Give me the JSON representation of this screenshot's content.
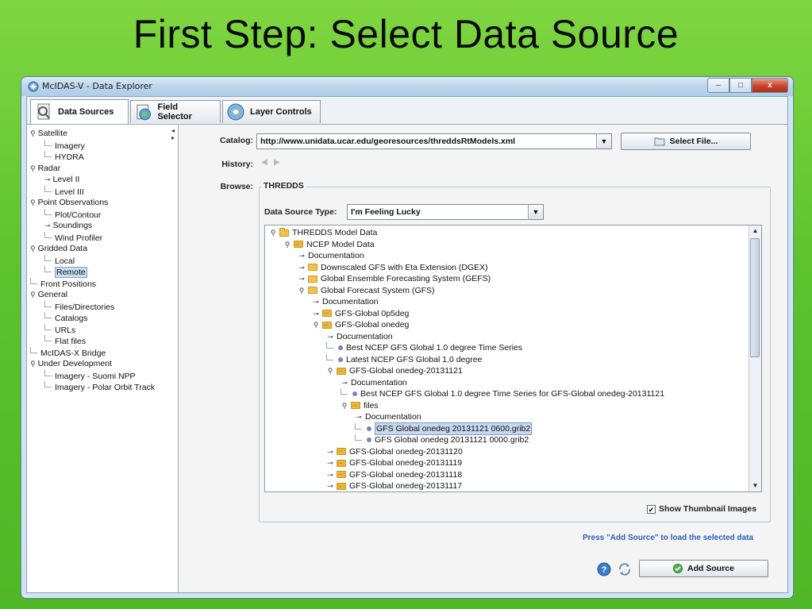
{
  "slide": {
    "title": "First Step:  Select Data Source"
  },
  "window": {
    "title": "McIDAS-V - Data Explorer",
    "buttons": {
      "minimize": "–",
      "maximize": "□",
      "close": "x"
    }
  },
  "tabs": [
    {
      "label": "Data Sources"
    },
    {
      "label": "Field Selector"
    },
    {
      "label": "Layer Controls"
    }
  ],
  "sidebar": {
    "items": [
      {
        "label": "Satellite",
        "level": 0,
        "handle": "⚲"
      },
      {
        "label": "Imagery",
        "level": 1
      },
      {
        "label": "HYDRA",
        "level": 1
      },
      {
        "label": "Radar",
        "level": 0,
        "handle": "⚲"
      },
      {
        "label": "Level II",
        "level": 1,
        "handle": "⊸"
      },
      {
        "label": "Level III",
        "level": 1
      },
      {
        "label": "Point Observations",
        "level": 0,
        "handle": "⚲"
      },
      {
        "label": "Plot/Contour",
        "level": 1
      },
      {
        "label": "Soundings",
        "level": 1,
        "handle": "⊸"
      },
      {
        "label": "Wind Profiler",
        "level": 1
      },
      {
        "label": "Gridded Data",
        "level": 0,
        "handle": "⚲"
      },
      {
        "label": "Local",
        "level": 1
      },
      {
        "label": "Remote",
        "level": 1,
        "selected": true
      },
      {
        "label": "Front Positions",
        "level": 0
      },
      {
        "label": "General",
        "level": 0,
        "handle": "⚲"
      },
      {
        "label": "Files/Directories",
        "level": 1
      },
      {
        "label": "Catalogs",
        "level": 1
      },
      {
        "label": "URLs",
        "level": 1
      },
      {
        "label": "Flat files",
        "level": 1
      },
      {
        "label": "McIDAS-X Bridge",
        "level": 0
      },
      {
        "label": "Under Development",
        "level": 0,
        "handle": "⚲"
      },
      {
        "label": "Imagery - Suomi NPP",
        "level": 1
      },
      {
        "label": "Imagery - Polar Orbit Track",
        "level": 1
      }
    ]
  },
  "main": {
    "catalog_label": "Catalog:",
    "catalog_value": "http://www.unidata.ucar.edu/georesources/threddsRtModels.xml",
    "select_file_button": "Select File...",
    "history_label": "History:",
    "browse_label": "Browse:",
    "browse_group": "THREDDS",
    "data_source_type_label": "Data Source Type:",
    "data_source_type_value": "I'm Feeling Lucky",
    "show_thumbnails_label": "Show Thumbnail Images",
    "show_thumbnails_checked": true,
    "hint_text": "Press \"Add Source\" to load the selected data",
    "add_source_button": "Add Source"
  },
  "data_tree": [
    {
      "label": "THREDDS Model Data",
      "depth": 0,
      "icon": "folder-open",
      "handle": "⚲"
    },
    {
      "label": "NCEP Model Data",
      "depth": 1,
      "icon": "folder-data",
      "handle": "⚲"
    },
    {
      "label": "Documentation",
      "depth": 2,
      "icon": "doc",
      "handle": "⊸"
    },
    {
      "label": "Downscaled GFS with Eta Extension (DGEX)",
      "depth": 2,
      "icon": "folder",
      "handle": "⊸"
    },
    {
      "label": "Global Ensemble Forecasting System (GEFS)",
      "depth": 2,
      "icon": "folder",
      "handle": "⊸"
    },
    {
      "label": "Global Forecast System (GFS)",
      "depth": 2,
      "icon": "folder",
      "handle": "⚲"
    },
    {
      "label": "Documentation",
      "depth": 3,
      "icon": "doc",
      "handle": "⊸"
    },
    {
      "label": "GFS-Global 0p5deg",
      "depth": 3,
      "icon": "folder-data",
      "handle": "⊸"
    },
    {
      "label": "GFS-Global onedeg",
      "depth": 3,
      "icon": "folder-data",
      "handle": "⚲"
    },
    {
      "label": "Documentation",
      "depth": 4,
      "icon": "doc",
      "handle": "⊸"
    },
    {
      "label": "Best NCEP GFS Global 1.0 degree Time Series",
      "depth": 4,
      "icon": "leaf"
    },
    {
      "label": "Latest NCEP GFS Global 1.0 degree",
      "depth": 4,
      "icon": "leaf"
    },
    {
      "label": "GFS-Global onedeg-20131121",
      "depth": 4,
      "icon": "folder-data",
      "handle": "⚲"
    },
    {
      "label": "Documentation",
      "depth": 5,
      "icon": "doc",
      "handle": "⊸"
    },
    {
      "label": "Best NCEP GFS Global 1.0 degree Time Series for GFS-Global onedeg-20131121",
      "depth": 5,
      "icon": "leaf"
    },
    {
      "label": "files",
      "depth": 5,
      "icon": "folder-data",
      "handle": "⚲"
    },
    {
      "label": "Documentation",
      "depth": 6,
      "icon": "doc",
      "handle": "⊸"
    },
    {
      "label": "GFS Global onedeg 20131121 0600.grib2",
      "depth": 6,
      "icon": "leaf",
      "selected": true
    },
    {
      "label": "GFS Global onedeg 20131121 0000.grib2",
      "depth": 6,
      "icon": "leaf"
    },
    {
      "label": "GFS-Global onedeg-20131120",
      "depth": 4,
      "icon": "folder-data",
      "handle": "⊸"
    },
    {
      "label": "GFS-Global onedeg-20131119",
      "depth": 4,
      "icon": "folder-data",
      "handle": "⊸"
    },
    {
      "label": "GFS-Global onedeg-20131118",
      "depth": 4,
      "icon": "folder-data",
      "handle": "⊸"
    },
    {
      "label": "GFS-Global onedeg-20131117",
      "depth": 4,
      "icon": "folder-data",
      "handle": "⊸"
    }
  ],
  "colors": {
    "slide_bg": "#5cc22e",
    "hint": "#2b5fb8",
    "selection": "#c7d8ee"
  }
}
